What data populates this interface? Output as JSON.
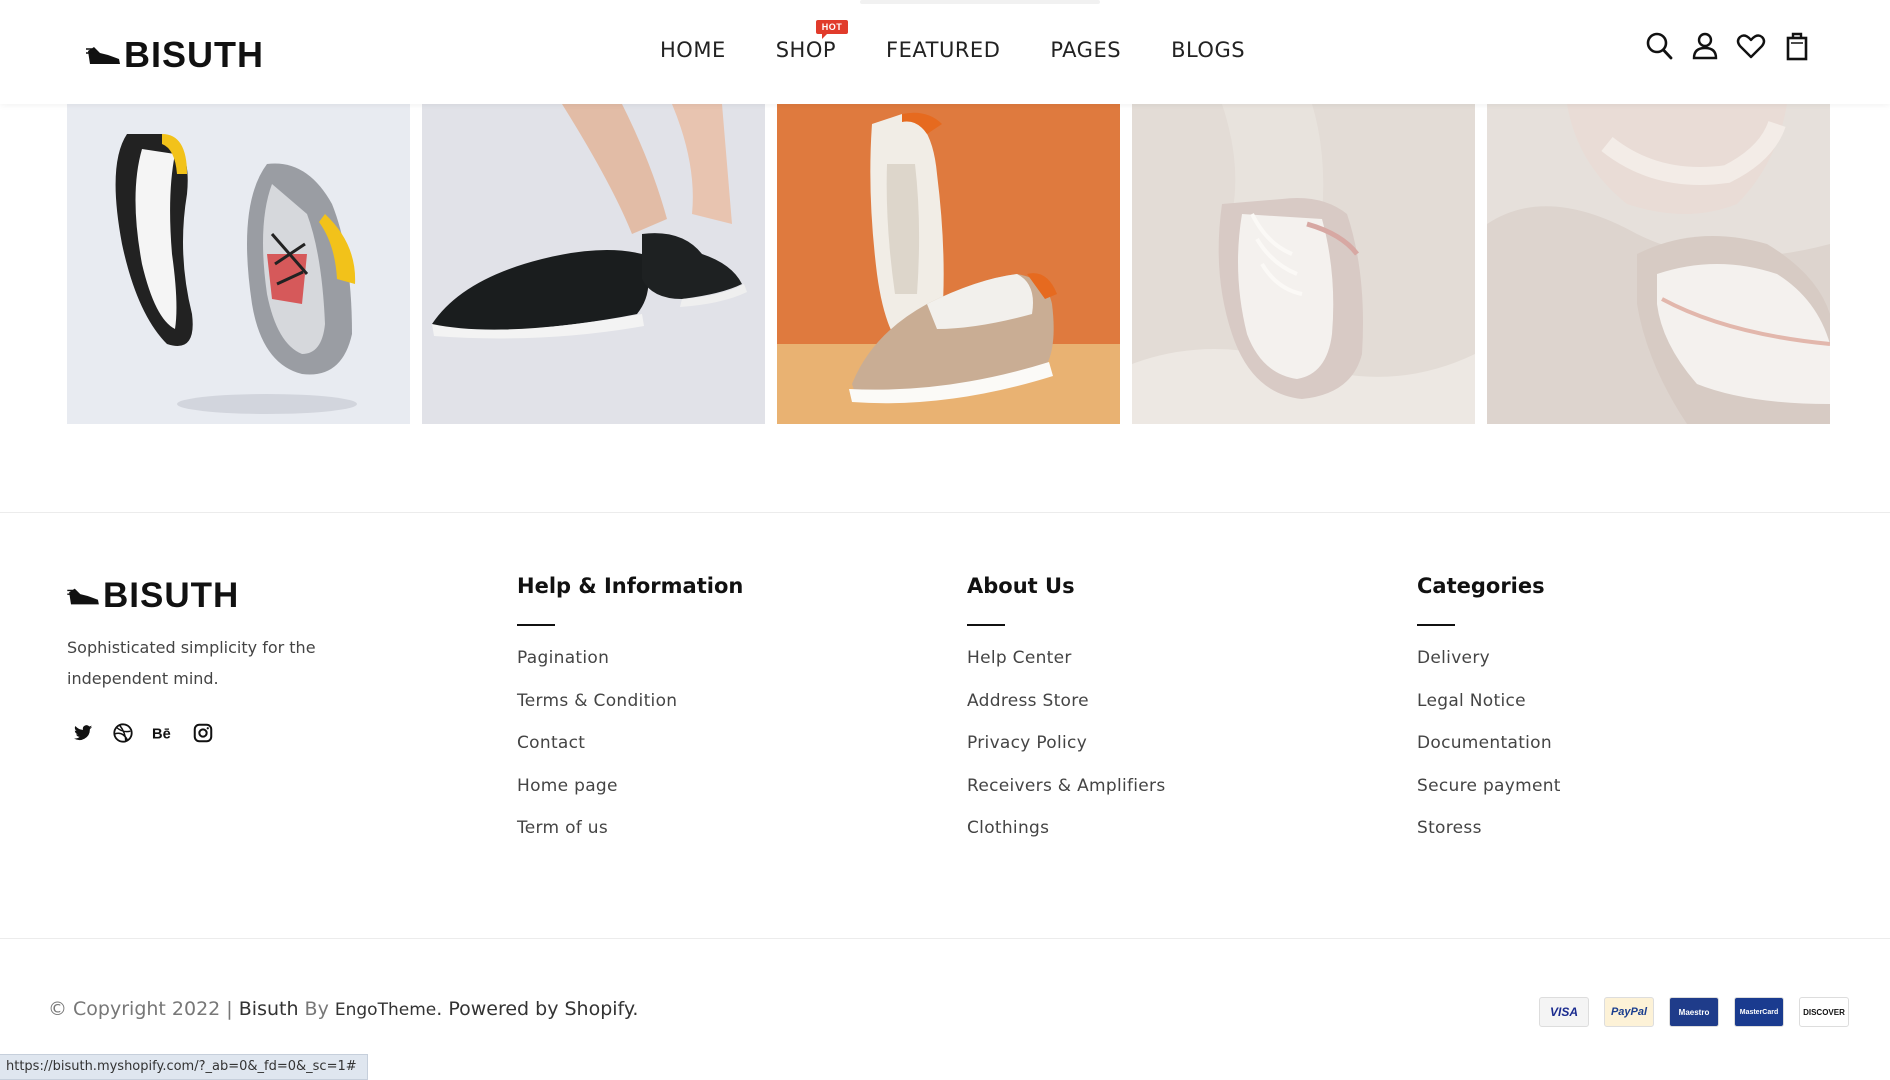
{
  "header": {
    "logo": "BISUTH",
    "nav": [
      {
        "label": "HOME"
      },
      {
        "label": "SHOP",
        "badge": "HOT"
      },
      {
        "label": "FEATURED"
      },
      {
        "label": "PAGES"
      },
      {
        "label": "BLOGS"
      }
    ],
    "icons": [
      "search-icon",
      "account-icon",
      "wishlist-heart-icon",
      "cart-bag-icon"
    ]
  },
  "gallery": {
    "images": [
      "sneakers-floating-grey-yellow",
      "black-knit-running-shoe",
      "beige-white-sneakers-orange-background",
      "white-pink-sneaker-on-sheet",
      "white-sneakers-closeup"
    ]
  },
  "footer": {
    "logo": "BISUTH",
    "tagline": "Sophisticated simplicity for the independent mind.",
    "social": [
      "twitter-icon",
      "dribbble-icon",
      "behance-icon",
      "instagram-icon"
    ],
    "columns": [
      {
        "title": "Help & Information",
        "links": [
          "Pagination",
          "Terms & Condition",
          "Contact",
          "Home page",
          "Term of us"
        ]
      },
      {
        "title": "About Us",
        "links": [
          "Help Center",
          "Address Store",
          "Privacy Policy",
          "Receivers & Amplifiers",
          "Clothings"
        ]
      },
      {
        "title": "Categories",
        "links": [
          "Delivery",
          "Legal Notice",
          "Documentation",
          "Secure payment",
          "Storess"
        ]
      }
    ],
    "copyright": {
      "prefix": "© Copyright 2022 | ",
      "brand": "Bisuth",
      "by": " By ",
      "author": "EngoTheme",
      "suffix": ". Powered by Shopify."
    },
    "payments": [
      "VISA",
      "PayPal",
      "Maestro",
      "MasterCard",
      "DISCOVER"
    ]
  },
  "statusbar": {
    "url": "https://bisuth.myshopify.com/?_ab=0&_fd=0&_sc=1#"
  },
  "colors": {
    "hot_badge": "#e13b2b",
    "text_dark": "#111111",
    "text_muted": "#444444"
  }
}
